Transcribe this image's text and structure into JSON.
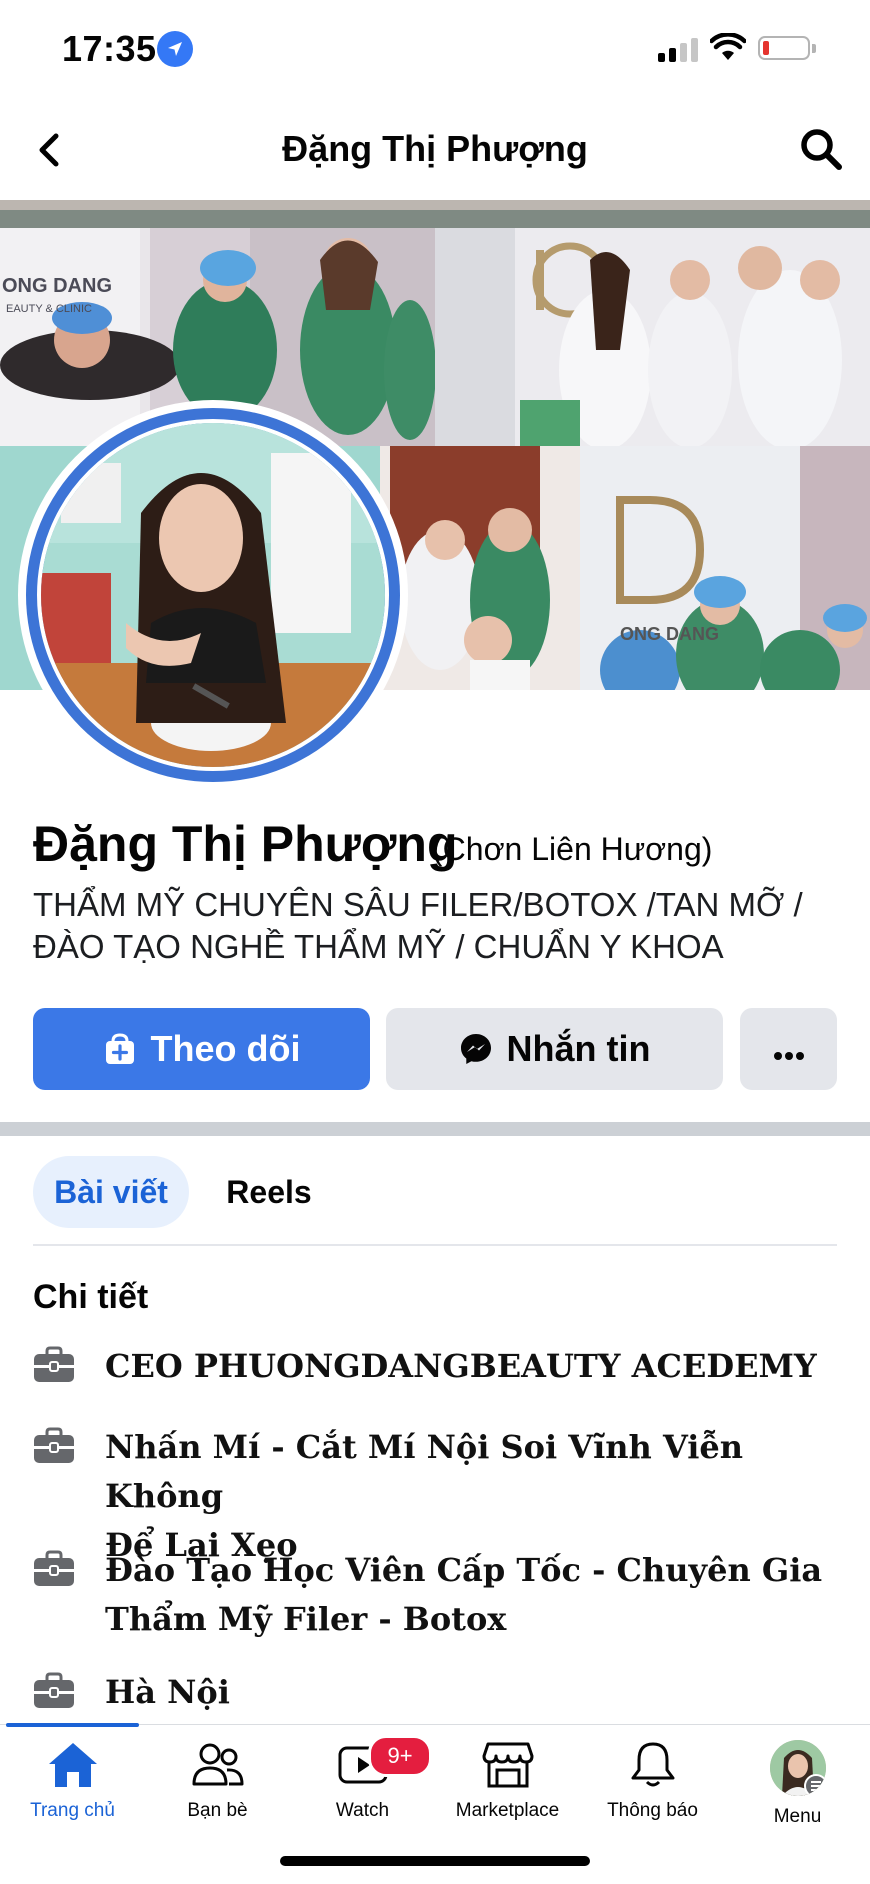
{
  "status_bar": {
    "time": "17:35"
  },
  "header": {
    "title": "Đặng Thị Phượng"
  },
  "profile": {
    "name": "Đặng Thị Phượng",
    "alternate_name": "(Chơn Liên Hương)",
    "bio_line1": "THẨM MỸ CHUYÊN SÂU FILER/BOTOX /TAN MỠ /",
    "bio_line2": "ĐÀO TẠO NGHỀ THẨM MỸ / CHUẨN Y KHOA",
    "cover_sign_1": "ONG DANG",
    "cover_sign_1_sub": "EAUTY & CLINIC",
    "cover_sign_2": "ONG DANG"
  },
  "actions": {
    "follow_label": "Theo dõi",
    "message_label": "Nhắn tin"
  },
  "tabs": [
    {
      "label": "Bài viết",
      "active": true
    },
    {
      "label": "Reels",
      "active": false
    }
  ],
  "details": {
    "title": "Chi tiết",
    "items": [
      {
        "icon": "briefcase-icon",
        "line1": "CEO PHUONGDANGBEAUTY ACEDEMY",
        "line2": ""
      },
      {
        "icon": "briefcase-icon",
        "line1": "Nhấn Mí - Cắt Mí Nội Soi Vĩnh Viễn Không",
        "line2": "Để Lại Xẹo"
      },
      {
        "icon": "briefcase-icon",
        "line1": "Đào Tạo Học Viên Cấp Tốc - Chuyên Gia",
        "line2": "Thẩm Mỹ Filer - Botox"
      },
      {
        "icon": "briefcase-icon",
        "line1": "Hà Nội",
        "line2": ""
      }
    ]
  },
  "bottom_nav": {
    "items": [
      {
        "label": "Trang chủ",
        "icon": "home-icon",
        "active": true
      },
      {
        "label": "Bạn bè",
        "icon": "friends-icon",
        "active": false
      },
      {
        "label": "Watch",
        "icon": "watch-icon",
        "active": false
      },
      {
        "label": "Marketplace",
        "icon": "marketplace-icon",
        "active": false
      },
      {
        "label": "Thông báo",
        "icon": "bell-icon",
        "active": false
      },
      {
        "label": "Menu",
        "icon": "menu-avatar",
        "active": false
      }
    ],
    "watch_badge": "9+"
  },
  "colors": {
    "accent": "#1b63d6",
    "follow_button": "#3b78e7",
    "secondary_button": "#e4e6eb",
    "badge": "#e41e3f"
  }
}
